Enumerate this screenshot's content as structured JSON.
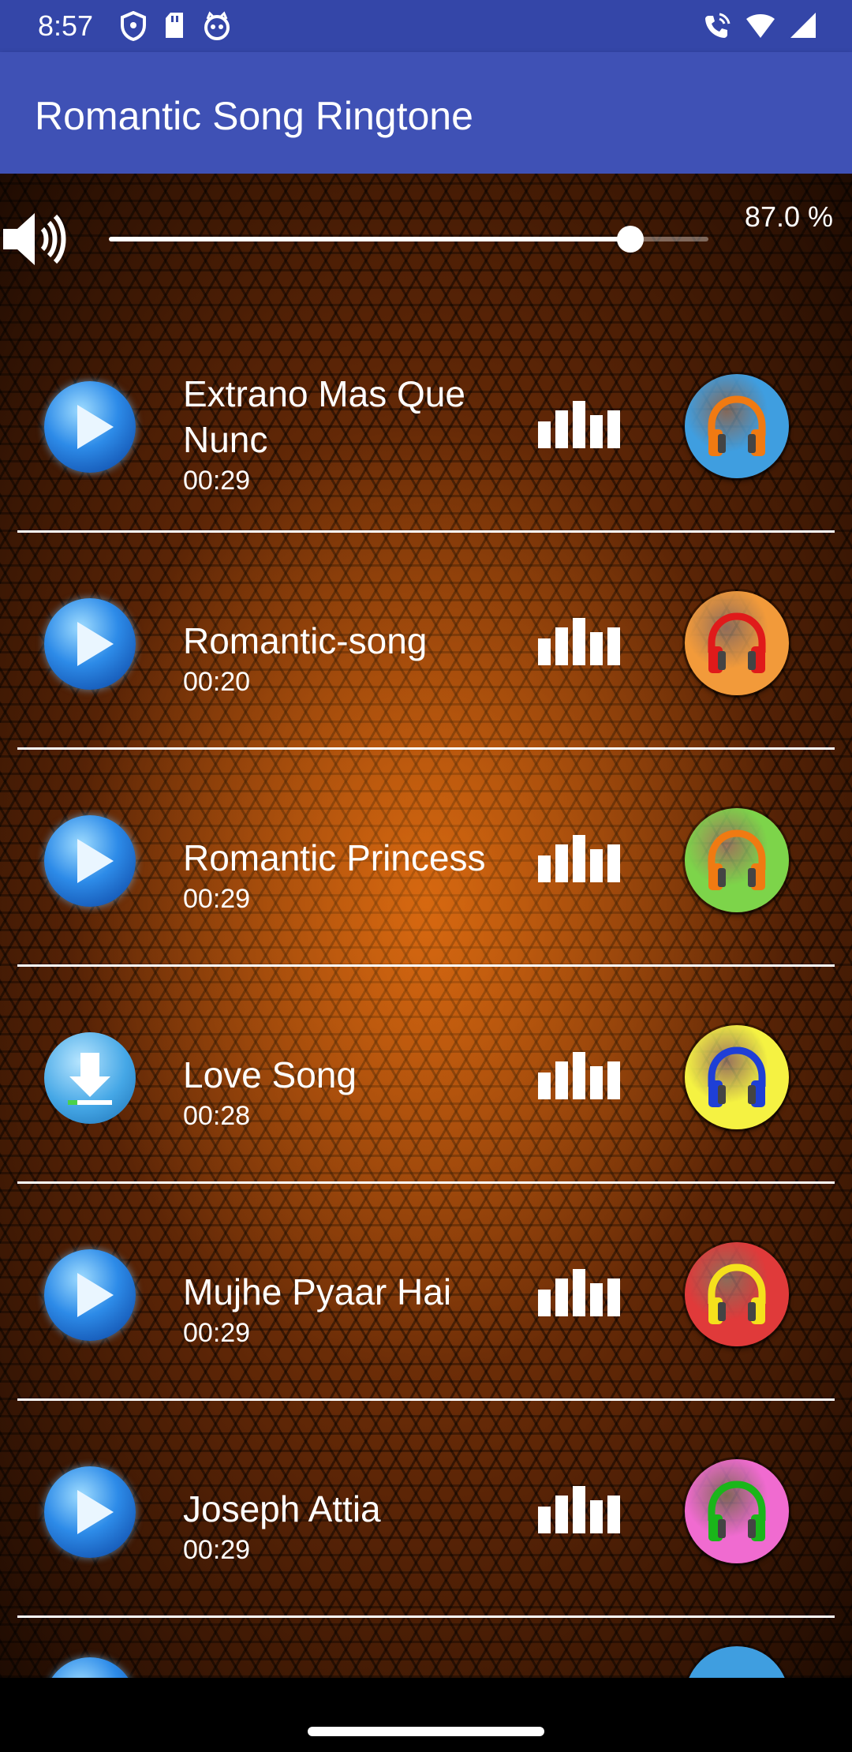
{
  "status_bar": {
    "time": "8:57",
    "icons_left": [
      "shield-icon",
      "sd-card-icon",
      "cat-face-icon"
    ],
    "icons_right": [
      "wifi-calling-icon",
      "wifi-icon",
      "signal-icon"
    ]
  },
  "app_bar": {
    "title": "Romantic Song Ringtone"
  },
  "volume": {
    "percent_text": "87.0 %",
    "level": 0.87
  },
  "songs": [
    {
      "title_line1": "Extrano Mas Que",
      "title_line2": "Nunc",
      "duration": "00:29",
      "button": "play",
      "headphone_color": "#3f9ee0",
      "headphone_band": "#f07a12"
    },
    {
      "title_line1": "Romantic-song",
      "title_line2": "",
      "duration": "00:20",
      "button": "play",
      "headphone_color": "#f29a3a",
      "headphone_band": "#e01a1a"
    },
    {
      "title_line1": "Romantic Princess",
      "title_line2": "",
      "duration": "00:29",
      "button": "play",
      "headphone_color": "#7dd44a",
      "headphone_band": "#f07a12"
    },
    {
      "title_line1": "Love Song",
      "title_line2": "",
      "duration": "00:28",
      "button": "download",
      "headphone_color": "#f5f242",
      "headphone_band": "#1e3fd6"
    },
    {
      "title_line1": "Mujhe Pyaar Hai",
      "title_line2": "",
      "duration": "00:29",
      "button": "play",
      "headphone_color": "#e03a3a",
      "headphone_band": "#f5e11c"
    },
    {
      "title_line1": "Joseph Attia",
      "title_line2": "",
      "duration": "00:29",
      "button": "play",
      "headphone_color": "#f06bd0",
      "headphone_band": "#1ab61a"
    }
  ],
  "partial_row": {
    "headphone_color": "#3f9ee0"
  }
}
